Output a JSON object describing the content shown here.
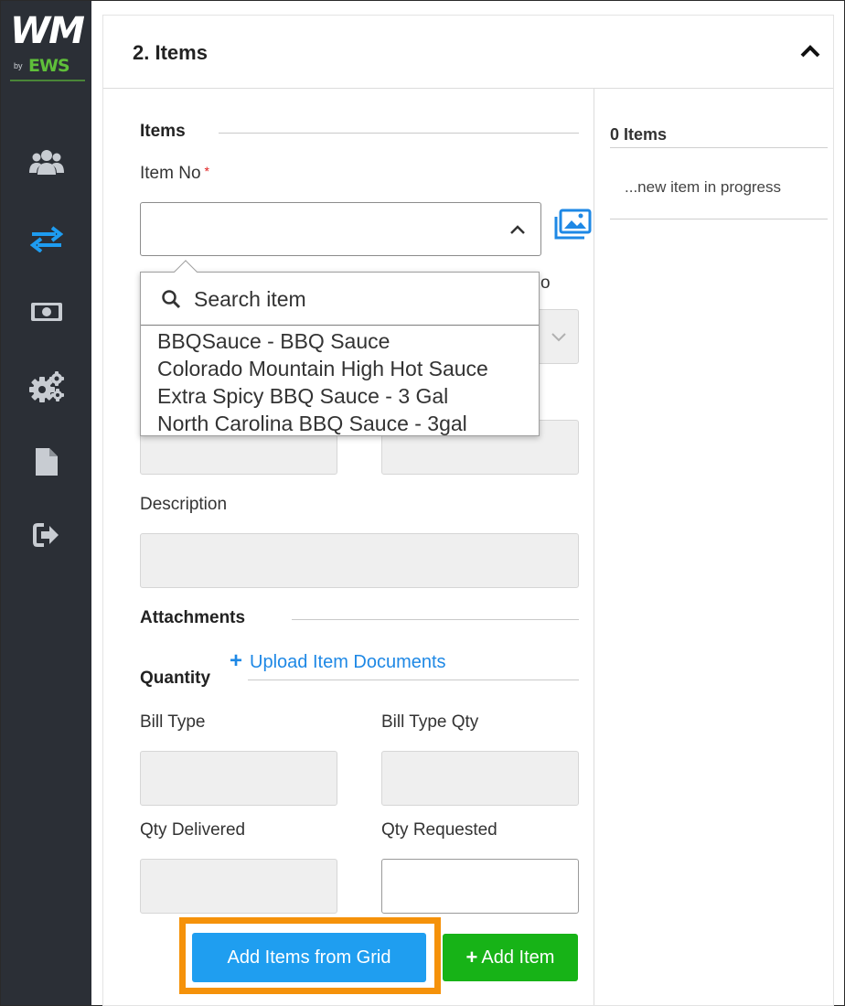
{
  "logo": {
    "wm": "WM",
    "by": "by",
    "ews": "EWS"
  },
  "sidebar": {
    "items": [
      {
        "icon": "users-icon"
      },
      {
        "icon": "transfer-arrows-icon"
      },
      {
        "icon": "money-icon"
      },
      {
        "icon": "gears-icon"
      },
      {
        "icon": "document-icon"
      },
      {
        "icon": "sign-out-icon"
      }
    ]
  },
  "panel": {
    "title": "2. Items",
    "collapse_icon": "chevron-up-icon"
  },
  "form": {
    "items_section": "Items",
    "item_no_label": "Item No",
    "required_mark": "*",
    "description_label": "Description",
    "attachments_section": "Attachments",
    "upload_label": "Upload Item Documents",
    "upload_plus": "+",
    "quantity_section": "Quantity",
    "bill_type_label": "Bill Type",
    "bill_type_qty_label": "Bill Type Qty",
    "qty_delivered_label": "Qty Delivered",
    "qty_requested_label": "Qty Requested",
    "partial_label_char": "o"
  },
  "dropdown": {
    "search_placeholder": "Search item",
    "options": [
      "BBQSauce - BBQ Sauce",
      "Colorado Mountain High Hot Sauce",
      "Extra Spicy BBQ Sauce - 3 Gal",
      "North Carolina BBQ Sauce - 3gal"
    ]
  },
  "buttons": {
    "add_from_grid": "Add Items from Grid",
    "add_item": "Add Item",
    "add_item_plus": "+"
  },
  "summary": {
    "count_label": "0 Items",
    "progress_text": "...new item in progress"
  },
  "colors": {
    "sidebar_bg": "#2b2f36",
    "accent_blue": "#1f9ef0",
    "add_green": "#17b317",
    "highlight_orange": "#f5920a",
    "logo_green": "#5fbf3a"
  }
}
